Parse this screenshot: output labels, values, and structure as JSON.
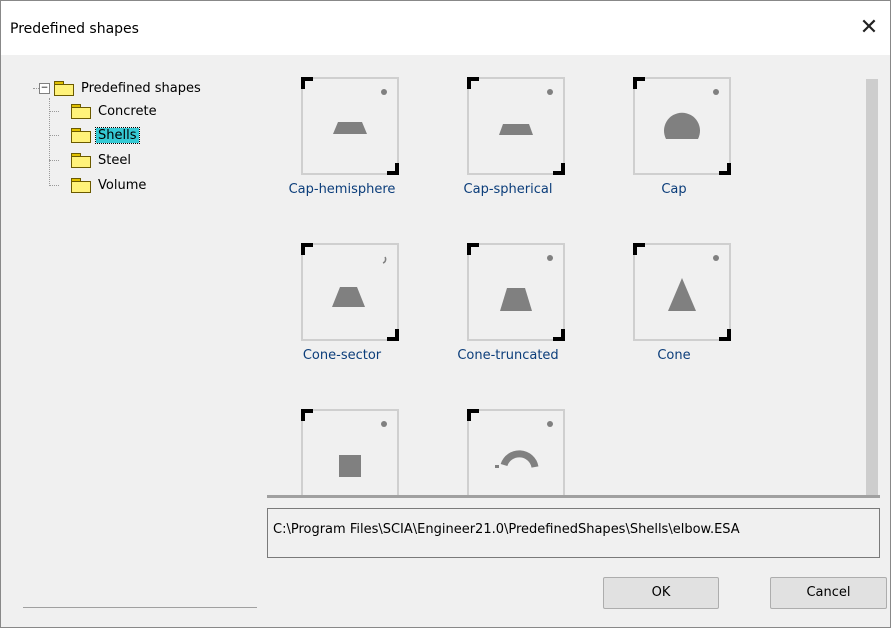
{
  "window": {
    "title": "Predefined shapes",
    "close_glyph": "✕"
  },
  "tree": {
    "root": {
      "label": "Predefined shapes",
      "expand_glyph": "−"
    },
    "children": [
      {
        "label": "Concrete",
        "selected": false
      },
      {
        "label": "Shells",
        "selected": true
      },
      {
        "label": "Steel",
        "selected": false
      },
      {
        "label": "Volume",
        "selected": false
      }
    ]
  },
  "shapes": [
    {
      "name": "Cap-hemisphere",
      "icon": "cap-hemisphere-icon"
    },
    {
      "name": "Cap-spherical",
      "icon": "cap-spherical-icon"
    },
    {
      "name": "Cap",
      "icon": "cap-icon"
    },
    {
      "name": "Cone-sector",
      "icon": "cone-sector-icon"
    },
    {
      "name": "Cone-truncated",
      "icon": "cone-truncated-icon"
    },
    {
      "name": "Cone",
      "icon": "cone-icon"
    },
    {
      "name": "",
      "icon": "square-icon"
    },
    {
      "name": "",
      "icon": "elbow-icon"
    }
  ],
  "path_field": {
    "value": "C:\\Program Files\\SCIA\\Engineer21.0\\PredefinedShapes\\Shells\\elbow.ESA"
  },
  "buttons": {
    "ok": "OK",
    "cancel": "Cancel"
  },
  "colors": {
    "selection": "#35c9d4",
    "caption": "#0b3d7a",
    "shape_fill": "#808080"
  }
}
